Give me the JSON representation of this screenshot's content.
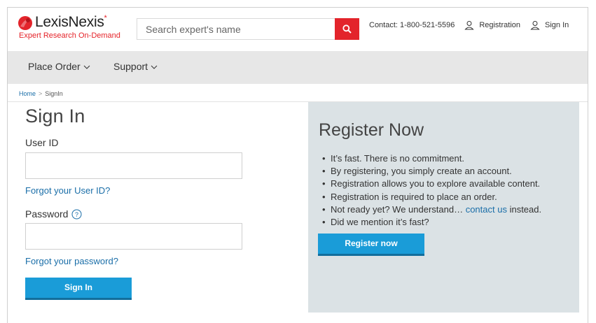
{
  "header": {
    "logo_name": "LexisNexis",
    "logo_mark": "*",
    "tagline": "Expert Research On-Demand",
    "search_placeholder": "Search expert's name",
    "contact": "Contact: 1-800-521-5596",
    "registration": "Registration",
    "signin": "Sign In"
  },
  "nav": {
    "place_order": "Place Order",
    "support": "Support"
  },
  "breadcrumb": {
    "home": "Home",
    "current": "SignIn"
  },
  "signin": {
    "title": "Sign In",
    "userid_label": "User ID",
    "userid_value": "",
    "forgot_userid": "Forgot your User ID?",
    "password_label": "Password",
    "password_value": "",
    "forgot_password": "Forgot your password?",
    "button": "Sign In"
  },
  "register": {
    "title": "Register Now",
    "bullets": {
      "b0": "It’s fast. There is no commitment.",
      "b1": "By registering, you simply create an account.",
      "b2": "Registration allows you to explore available content.",
      "b3": "Registration is required to place an order.",
      "b4_pre": "Not ready yet? We understand… ",
      "b4_link": "contact us",
      "b4_post": " instead.",
      "b5": "Did we mention it’s fast?"
    },
    "button": "Register now"
  },
  "colors": {
    "brand_red": "#e3242b",
    "link_blue": "#1a6ea8",
    "button_blue": "#1a9cd8",
    "nav_gray": "#e7e7e7",
    "panel_gray": "#dbe2e5"
  },
  "icons": {
    "search": "magnifier-icon",
    "user": "person-outline-icon",
    "help": "question-circle-icon",
    "chevron": "chevron-down-icon"
  }
}
